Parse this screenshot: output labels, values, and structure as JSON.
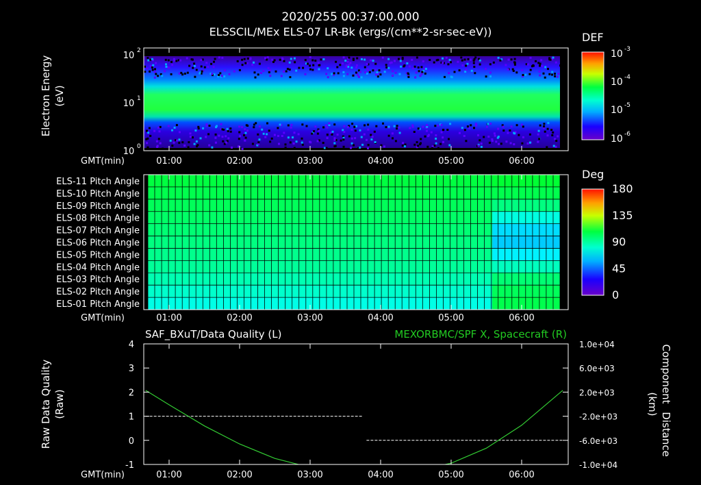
{
  "header": {
    "timestamp": "2020/255 00:37:00.000",
    "subtitle": "ELSSCIL/MEx ELS-07 LR-Bk  (ergs/(cm**2-sr-sec-eV))"
  },
  "time_ticks": [
    "01:00",
    "02:00",
    "03:00",
    "04:00",
    "05:00",
    "06:00"
  ],
  "gmt_label": "GMT(min)",
  "colors": {
    "axis": "#ffffff",
    "grid": "#000000",
    "dq_line": "#ffffff",
    "distance_line": "#33cc33",
    "right_title": "#22cc22"
  },
  "chart_data": [
    {
      "type": "heatmap",
      "ylabel_line1": "Electron Energy",
      "ylabel_line2": "(eV)",
      "y_scale": "log",
      "ylim": [
        1,
        150
      ],
      "y_ticks": [
        {
          "base": "10",
          "exp": "0",
          "value": 1
        },
        {
          "base": "10",
          "exp": "1",
          "value": 10
        },
        {
          "base": "10",
          "exp": "2",
          "value": 100
        }
      ],
      "x_ticks": [
        "01:00",
        "02:00",
        "03:00",
        "04:00",
        "05:00",
        "06:00"
      ],
      "colorbar": {
        "title": "DEF",
        "scale": "log",
        "labels": [
          {
            "base": "10",
            "exp": "-3"
          },
          {
            "base": "10",
            "exp": "-4"
          },
          {
            "base": "10",
            "exp": "-5"
          },
          {
            "base": "10",
            "exp": "-6"
          }
        ]
      },
      "description_peak_energy_eV": 15
    },
    {
      "type": "heatmap",
      "rows": [
        "ELS-11 Pitch Angle",
        "ELS-10 Pitch Angle",
        "ELS-09 Pitch Angle",
        "ELS-08 Pitch Angle",
        "ELS-07 Pitch Angle",
        "ELS-06 Pitch Angle",
        "ELS-05 Pitch Angle",
        "ELS-04 Pitch Angle",
        "ELS-03 Pitch Angle",
        "ELS-02 Pitch Angle",
        "ELS-01 Pitch Angle"
      ],
      "x_ticks": [
        "01:00",
        "02:00",
        "03:00",
        "04:00",
        "05:00",
        "06:00"
      ],
      "grid": true,
      "colorbar": {
        "title": "Deg",
        "labels": [
          "180",
          "135",
          "90",
          "45",
          "0"
        ],
        "range": [
          0,
          180
        ]
      },
      "pitch_angle_deg_early": [
        90,
        88,
        86,
        84,
        82,
        80,
        78,
        76,
        72,
        68,
        64
      ],
      "pitch_angle_deg_late": [
        92,
        88,
        80,
        65,
        55,
        52,
        58,
        70,
        82,
        86,
        88
      ]
    },
    {
      "type": "line",
      "title_left": "SAF_BXuT/Data Quality (L)",
      "title_right": "MEXORBMC/SPF X, Spacecraft (R)",
      "ylabel_left_line1": "Raw Data Quality",
      "ylabel_left_line2": "(Raw)",
      "ylabel_right_line1": "Component",
      "ylabel_right_line2": "Distance",
      "ylabel_right_line3": "(km)",
      "ylim_left": [
        -1,
        4
      ],
      "y_ticks_left": [
        "4",
        "3",
        "2",
        "1",
        "0",
        "-1"
      ],
      "ylim_right": [
        -10000,
        10000
      ],
      "y_ticks_right": [
        "1.0e+04",
        "6.0e+03",
        "2.0e+03",
        "-2.0e+03",
        "-6.0e+03",
        "-1.0e+04"
      ],
      "x_ticks": [
        "01:00",
        "02:00",
        "03:00",
        "04:00",
        "05:00",
        "06:00"
      ],
      "series": [
        {
          "name": "SAF_BXuT/Data Quality",
          "axis": "left",
          "x": [
            "00:40",
            "03:45",
            "03:48",
            "06:35"
          ],
          "values": [
            1,
            1,
            0,
            0
          ]
        },
        {
          "name": "MEXORBMC/SPF X, Spacecraft",
          "axis": "right",
          "x": [
            "00:40",
            "01:00",
            "01:30",
            "02:00",
            "02:30",
            "03:00",
            "03:30",
            "04:00",
            "04:30",
            "05:00",
            "05:30",
            "06:00",
            "06:35"
          ],
          "values": [
            2300,
            -100,
            -3600,
            -6600,
            -9000,
            -10500,
            -11200,
            -11600,
            -11000,
            -9800,
            -7300,
            -3500,
            2300
          ]
        }
      ]
    }
  ]
}
